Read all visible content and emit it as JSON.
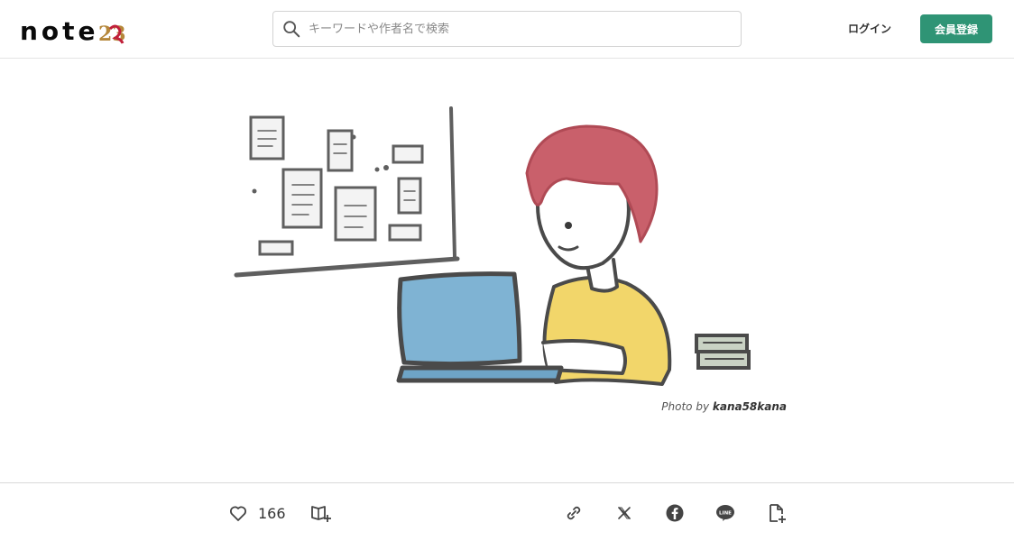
{
  "header": {
    "logo_text": "note",
    "logo_badge": "23",
    "search_placeholder": "キーワードや作者名で検索",
    "login_label": "ログイン",
    "signup_label": "会員登録"
  },
  "hero": {
    "credit_prefix": "Photo by ",
    "credit_author": "kana58kana"
  },
  "actions": {
    "like_count": "166"
  },
  "colors": {
    "brand_green": "#2f9475",
    "laptop_blue": "#7fb3d3",
    "shirt_yellow": "#f2d66a",
    "hair_red": "#c9606b"
  }
}
